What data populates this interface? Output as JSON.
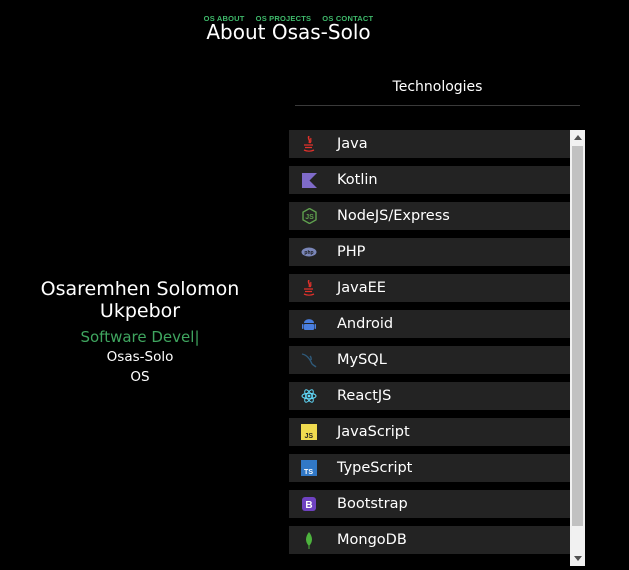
{
  "nav": {
    "about": "OS ABOUT",
    "projects": "OS PROJECTS",
    "contact": "OS CONTACT"
  },
  "title": "About Osas-Solo",
  "profile": {
    "name": "Osaremhen Solomon Ukpebor",
    "role": "Software Devel",
    "caret": "|",
    "handle": "Osas-Solo",
    "initials": "OS"
  },
  "technologies": {
    "heading": "Technologies",
    "items": [
      {
        "label": "Java",
        "icon": "java-icon",
        "color": "#e2312b"
      },
      {
        "label": "Kotlin",
        "icon": "kotlin-icon",
        "color": "#7f6bc9"
      },
      {
        "label": "NodeJS/Express",
        "icon": "nodejs-icon",
        "color": "#5fa04e"
      },
      {
        "label": "PHP",
        "icon": "php-icon",
        "color": "#7a86b8"
      },
      {
        "label": "JavaEE",
        "icon": "java-icon",
        "color": "#e2312b"
      },
      {
        "label": "Android",
        "icon": "android-icon",
        "color": "#4a7fe0"
      },
      {
        "label": "MySQL",
        "icon": "mysql-icon",
        "color": "#2f5a7a"
      },
      {
        "label": "ReactJS",
        "icon": "react-icon",
        "color": "#61dafb"
      },
      {
        "label": "JavaScript",
        "icon": "javascript-icon",
        "color": "#f0db4f"
      },
      {
        "label": "TypeScript",
        "icon": "typescript-icon",
        "color": "#3178c6"
      },
      {
        "label": "Bootstrap",
        "icon": "bootstrap-icon",
        "color": "#6f42c1"
      },
      {
        "label": "MongoDB",
        "icon": "mongodb-icon",
        "color": "#4db33d"
      }
    ]
  }
}
